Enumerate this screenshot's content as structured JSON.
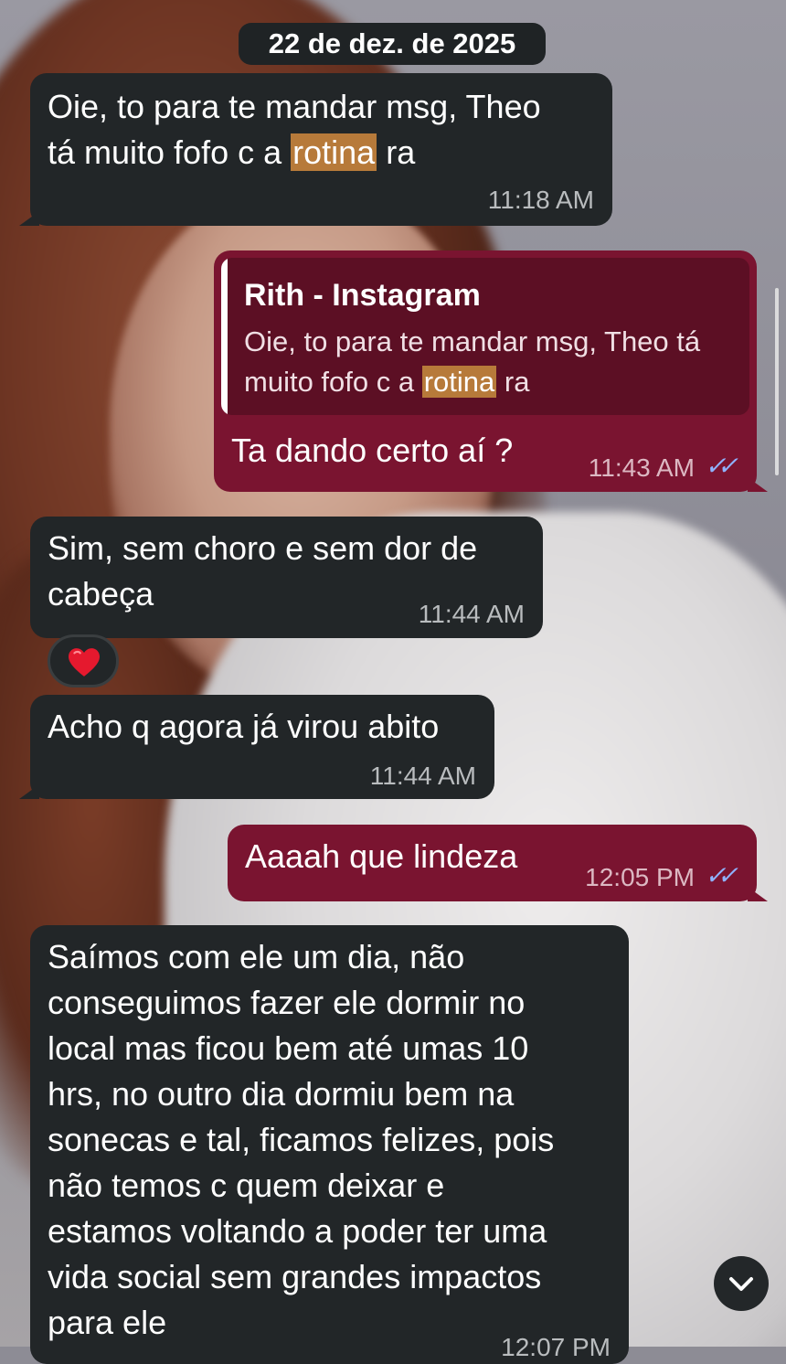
{
  "date_separator": "22 de dez. de 2025",
  "messages": [
    {
      "direction": "in",
      "text_before": "Oie, to para te mandar msg, Theo\ntá muito fofo c a ",
      "highlight": "rotina",
      "text_after": " ra",
      "time": "11:18 AM"
    },
    {
      "direction": "out",
      "reply": {
        "author": "Rith - Instagram",
        "text_before": "Oie, to para te mandar msg, Theo tá muito fofo c a ",
        "highlight": "rotina",
        "text_after": " ra"
      },
      "text": "Ta dando certo aí ?",
      "time": "11:43 AM",
      "status": "read"
    },
    {
      "direction": "in",
      "text": "Sim, sem choro e sem dor de\ncabeça",
      "time": "11:44 AM",
      "reaction": "heart"
    },
    {
      "direction": "in",
      "text": "Acho q agora já virou abito",
      "time": "11:44 AM"
    },
    {
      "direction": "out",
      "text": "Aaaah que lindeza",
      "time": "12:05 PM",
      "status": "read"
    },
    {
      "direction": "in",
      "text": "Saímos com ele um dia, não\nconseguimos fazer ele dormir no\nlocal mas ficou bem até umas 10\nhrs, no outro dia dormiu bem na\nsonecas e tal, ficamos felizes, pois\nnão temos c quem deixar e\nestamos voltando a poder ter uma\nvida social sem grandes impactos\npara ele",
      "time": "12:07 PM"
    }
  ],
  "icons": {
    "read_ticks": "double-check-icon",
    "reaction": "heart-icon",
    "scroll": "chevron-down-icon"
  },
  "colors": {
    "incoming_bubble": "#222628",
    "outgoing_bubble": "#7a1430",
    "quote_background": "#5c0f24",
    "highlight": "#b77a3a",
    "read_ticks": "#8fb3ff"
  }
}
